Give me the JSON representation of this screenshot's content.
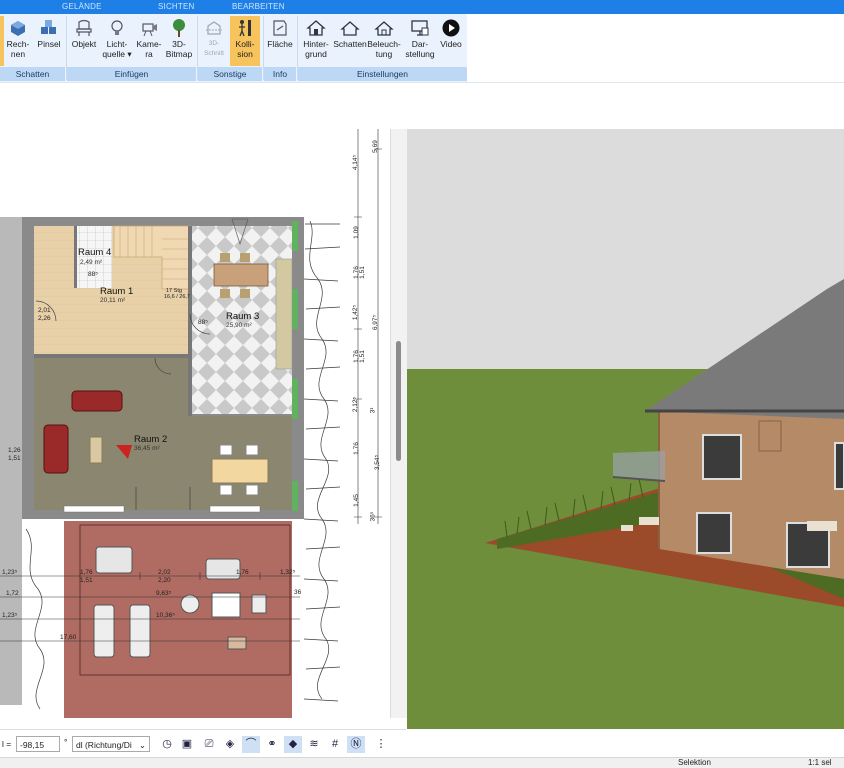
{
  "tabs": [
    "GELÄNDE",
    "SICHTEN",
    "BEARBEITEN"
  ],
  "ribbon": {
    "buttons": [
      {
        "id": "rechnen",
        "label": "Rech-\nnen",
        "icon": "cube-icon"
      },
      {
        "id": "pinsel",
        "label": "Pinsel",
        "icon": "cubes-icon"
      },
      {
        "id": "objekt",
        "label": "Objekt",
        "icon": "chair-icon"
      },
      {
        "id": "lichtquelle",
        "label": "Licht-\nquelle ▾",
        "icon": "bulb-icon"
      },
      {
        "id": "kamera",
        "label": "Kame-\nra",
        "icon": "camera-icon"
      },
      {
        "id": "bitmap",
        "label": "3D-\nBitmap",
        "icon": "tree-icon"
      },
      {
        "id": "schnitt",
        "label": "3D-\nSchnitt",
        "icon": "section-icon"
      },
      {
        "id": "kollision",
        "label": "Kolli-\nsion",
        "icon": "collision-icon"
      },
      {
        "id": "flaeche",
        "label": "Fläche",
        "icon": "area-icon"
      },
      {
        "id": "hintergrund",
        "label": "Hinter-\ngrund",
        "icon": "house-bg-icon"
      },
      {
        "id": "schatten",
        "label": "Schatten",
        "icon": "house-shadow-icon"
      },
      {
        "id": "beleuchtung",
        "label": "Beleuch-\ntung",
        "icon": "house-light-icon"
      },
      {
        "id": "darstellung",
        "label": "Dar-\nstellung",
        "icon": "monitor-icon"
      },
      {
        "id": "video",
        "label": "Video",
        "icon": "play-icon"
      }
    ],
    "groups": [
      "Schatten",
      "Einfügen",
      "Sonstige",
      "Info",
      "Einstellungen"
    ]
  },
  "plan": {
    "rooms": [
      {
        "name": "Raum 4",
        "area": "2,49 m²"
      },
      {
        "name": "Raum 1",
        "area": "20,11 m²"
      },
      {
        "name": "Raum 3",
        "area": "25,90 m²"
      },
      {
        "name": "Raum 2",
        "area": "36,45 m²"
      }
    ],
    "dims_right": [
      "5,69",
      "4,14⁵",
      "1,09",
      "1,76",
      "1,51",
      "1,42⁵",
      "6,97⁵",
      "1,76",
      "1,51",
      "2,12⁵",
      "3¹",
      "1,76",
      "3,54⁵",
      "1,45",
      "36⁵"
    ],
    "dims_bottom": [
      "1,23⁵",
      "1,76",
      "1,51",
      "2,02",
      "2,20",
      "1,76",
      "1,32⁵",
      "1,72",
      "9,63⁵",
      "1,23⁵",
      "10,36⁵",
      "17,60",
      "36"
    ],
    "small_labels": [
      "2,01",
      "2,26",
      "88⁵",
      "2,01",
      "88⁵",
      "2,01",
      "88⁵",
      "2,01",
      "1,26",
      "1,51",
      "17 Stg",
      "16,6 / 26,7"
    ]
  },
  "toolbar": {
    "coord_prefix": "l =",
    "coord_value": "-98,15",
    "degree": "°",
    "direction_value": "dl (Richtung/Di"
  },
  "status": {
    "mode": "Selektion",
    "scale": "1:1 sel"
  },
  "colors": {
    "tab_blue": "#1e7fe6",
    "ribbon_bg": "#eaf3fd",
    "group_bar": "#bcd8f4",
    "active_button": "#f6c35c",
    "floor_wood": "#e8d1a9",
    "floor_stone": "#8a8670",
    "terrace_red": "#b06b62",
    "grass": "#6e8e3c"
  }
}
